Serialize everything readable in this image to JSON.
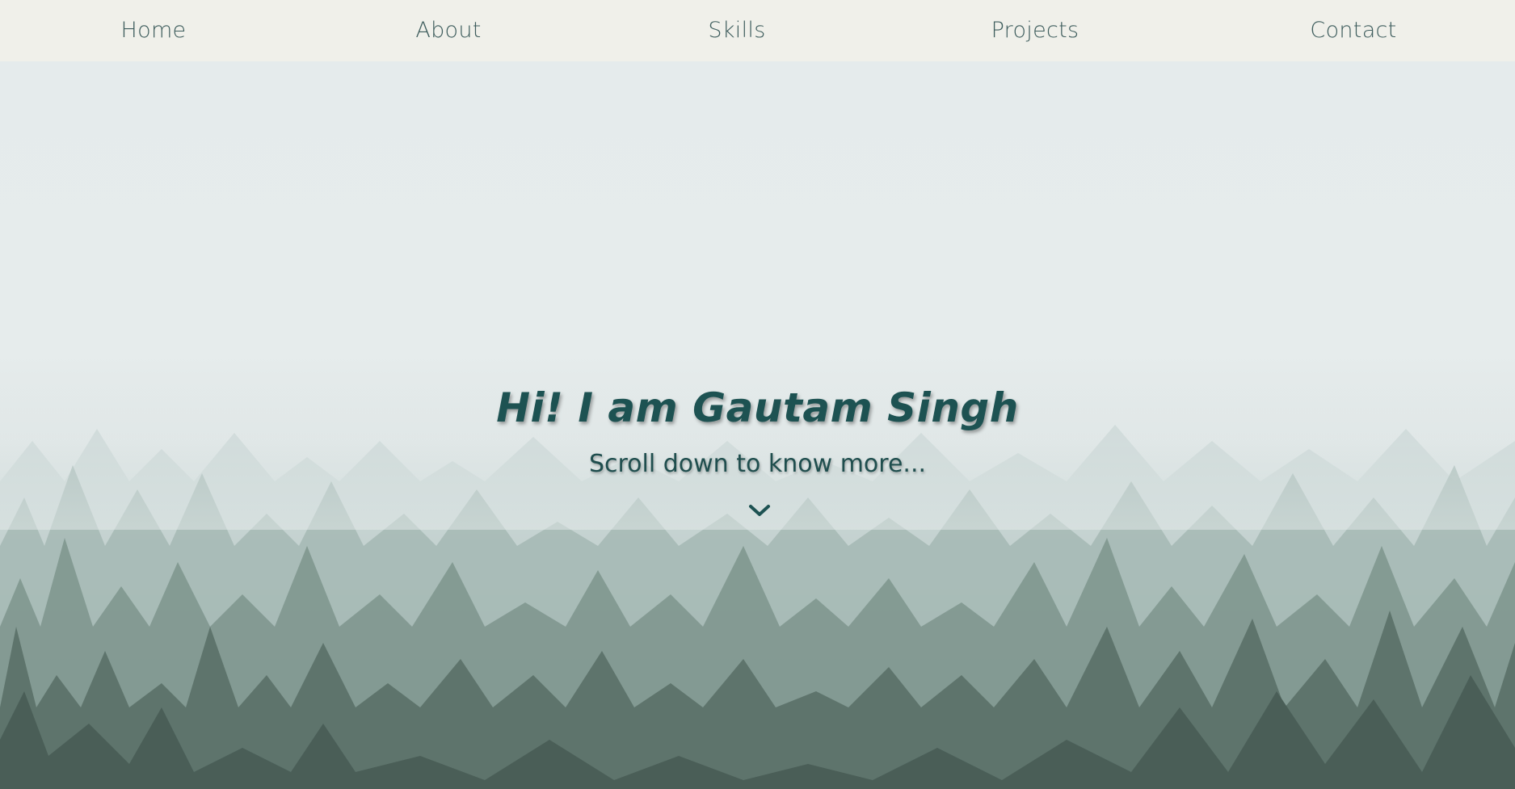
{
  "nav": {
    "items": [
      {
        "label": "Home"
      },
      {
        "label": "About"
      },
      {
        "label": "Skills"
      },
      {
        "label": "Projects"
      },
      {
        "label": "Contact"
      }
    ]
  },
  "hero": {
    "title": "Hi! I am Gautam Singh",
    "subtitle": "Scroll down to know more...",
    "scroll_icon": "chevron-down-icon"
  },
  "colors": {
    "nav_background": "#f0f0ea",
    "nav_text": "#3d5c5c",
    "accent": "#1d5252"
  }
}
